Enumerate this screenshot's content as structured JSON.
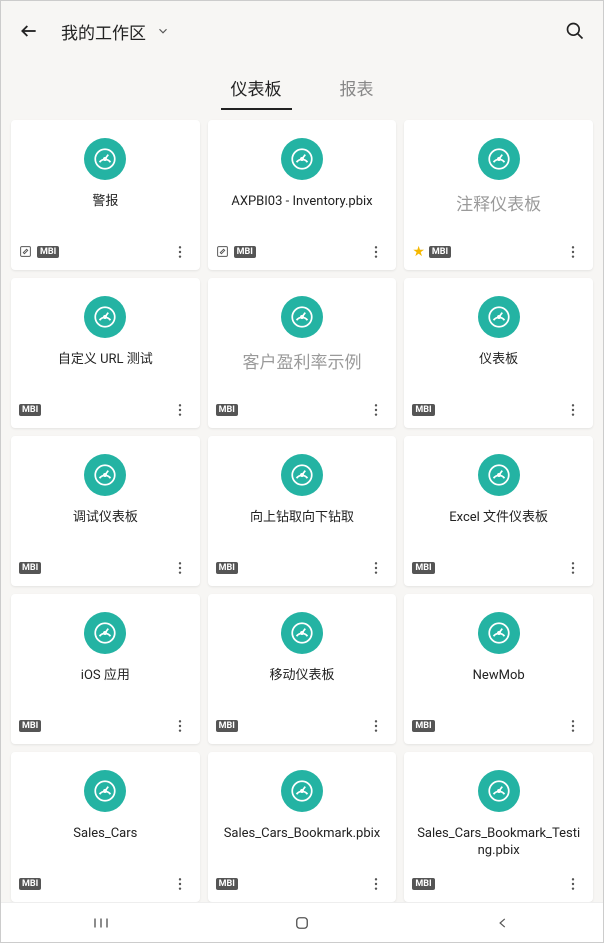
{
  "header": {
    "workspace_title": "我的工作区"
  },
  "tabs": {
    "dashboard": "仪表板",
    "report": "报表",
    "active": "dashboard"
  },
  "badge_text": "MBI",
  "cards": [
    {
      "title": "警报",
      "hasEdit": true,
      "hasBadge": true,
      "hasStar": false,
      "gray": false
    },
    {
      "title": "AXPBI03 - Inventory.pbix",
      "hasEdit": true,
      "hasBadge": true,
      "hasStar": false,
      "gray": false
    },
    {
      "title": "注释仪表板",
      "hasEdit": false,
      "hasBadge": true,
      "hasStar": true,
      "gray": true
    },
    {
      "title": "自定义 URL 测试",
      "hasEdit": false,
      "hasBadge": true,
      "hasStar": false,
      "gray": false
    },
    {
      "title": "客户盈利率示例",
      "hasEdit": false,
      "hasBadge": true,
      "hasStar": false,
      "gray": true
    },
    {
      "title": "仪表板",
      "hasEdit": false,
      "hasBadge": true,
      "hasStar": false,
      "gray": false
    },
    {
      "title": "调试仪表板",
      "hasEdit": false,
      "hasBadge": true,
      "hasStar": false,
      "gray": false
    },
    {
      "title": "向上钻取向下钻取",
      "hasEdit": false,
      "hasBadge": true,
      "hasStar": false,
      "gray": false
    },
    {
      "title": "Excel 文件仪表板",
      "hasEdit": false,
      "hasBadge": true,
      "hasStar": false,
      "gray": false
    },
    {
      "title": "iOS 应用",
      "hasEdit": false,
      "hasBadge": true,
      "hasStar": false,
      "gray": false
    },
    {
      "title": "移动仪表板",
      "hasEdit": false,
      "hasBadge": true,
      "hasStar": false,
      "gray": false
    },
    {
      "title": "NewMob",
      "hasEdit": false,
      "hasBadge": true,
      "hasStar": false,
      "gray": false
    },
    {
      "title": "Sales_Cars",
      "hasEdit": false,
      "hasBadge": true,
      "hasStar": false,
      "gray": false
    },
    {
      "title": "Sales_Cars_Bookmark.pbix",
      "hasEdit": false,
      "hasBadge": true,
      "hasStar": false,
      "gray": false
    },
    {
      "title": "Sales_Cars_Bookmark_Testing.pbix",
      "hasEdit": false,
      "hasBadge": true,
      "hasStar": false,
      "gray": false
    }
  ]
}
